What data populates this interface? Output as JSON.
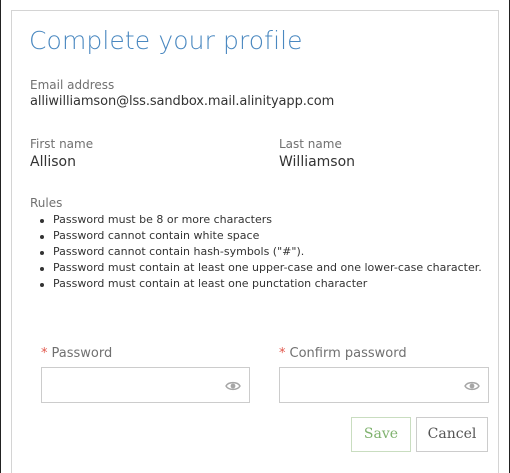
{
  "dialog": {
    "title": "Complete your profile"
  },
  "email": {
    "label": "Email address",
    "value": "alliwilliamson@lss.sandbox.mail.alinityapp.com"
  },
  "first_name": {
    "label": "First name",
    "value": "Allison"
  },
  "last_name": {
    "label": "Last name",
    "value": "Williamson"
  },
  "rules": {
    "label": "Rules",
    "items": [
      "Password must be 8 or more characters",
      "Password cannot contain white space",
      "Password cannot contain hash-symbols (\"#\").",
      "Password must contain at least one upper-case and one lower-case character.",
      "Password must contain at least one punctation character"
    ]
  },
  "password": {
    "required_marker": "*",
    "label": "Password",
    "value": "",
    "placeholder": ""
  },
  "confirm_password": {
    "required_marker": "*",
    "label": "Confirm password",
    "value": "",
    "placeholder": ""
  },
  "buttons": {
    "save": "Save",
    "cancel": "Cancel"
  },
  "colors": {
    "title": "#4a88c0",
    "required": "#e2574c",
    "save_text": "#7fb26e"
  },
  "icons": {
    "password_toggle": "eye-icon",
    "confirm_toggle": "eye-icon"
  }
}
